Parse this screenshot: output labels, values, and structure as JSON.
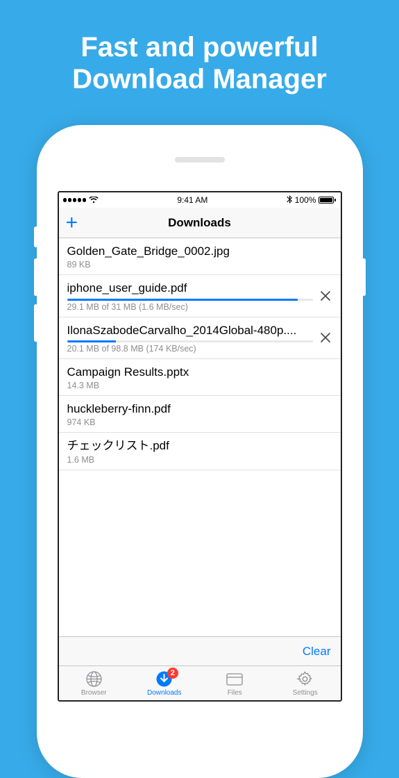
{
  "promo": {
    "line1": "Fast and powerful",
    "line2": "Download Manager"
  },
  "status_bar": {
    "time": "9:41 AM",
    "battery_pct": "100%"
  },
  "nav": {
    "title": "Downloads",
    "add_label": "+"
  },
  "downloads": [
    {
      "name": "Golden_Gate_Bridge_0002.jpg",
      "meta": "89 KB",
      "downloading": false
    },
    {
      "name": "iphone_user_guide.pdf",
      "meta": "29.1 MB of 31 MB (1.6 MB/sec)",
      "downloading": true,
      "progress": 0.94
    },
    {
      "name": "IlonaSzabodeCarvalho_2014Global-480p....",
      "meta": "20.1 MB of 98.8 MB (174 KB/sec)",
      "downloading": true,
      "progress": 0.2
    },
    {
      "name": "Campaign Results.pptx",
      "meta": "14.3 MB",
      "downloading": false
    },
    {
      "name": "huckleberry-finn.pdf",
      "meta": "974 KB",
      "downloading": false
    },
    {
      "name": "チェックリスト.pdf",
      "meta": "1.6 MB",
      "downloading": false
    }
  ],
  "toolbar": {
    "clear_label": "Clear"
  },
  "tabs": {
    "browser": "Browser",
    "downloads": "Downloads",
    "files": "Files",
    "settings": "Settings",
    "badge": "2"
  }
}
